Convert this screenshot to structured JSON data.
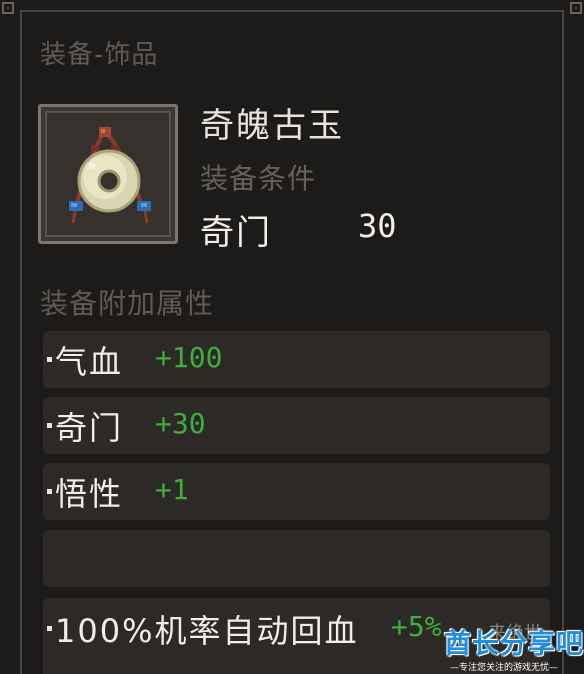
{
  "tooltip": {
    "category": "装备-饰品",
    "item": {
      "name": "奇魄古玉",
      "icon": "jade-pendant-icon"
    },
    "requirement": {
      "label": "装备条件",
      "stat": "奇门",
      "value": "30"
    },
    "attributes_title": "装备附加属性",
    "attributes": [
      {
        "stat": "气血",
        "bonus": "+100"
      },
      {
        "stat": "奇门",
        "bonus": "+30"
      },
      {
        "stat": "悟性",
        "bonus": "+1"
      },
      {
        "stat": "",
        "bonus": ""
      },
      {
        "stat": "100%机率自动回血",
        "bonus": "+5%"
      }
    ]
  },
  "watermark": {
    "title": "酋长分享吧",
    "subtitle": "—专注您关注的游戏无忧—",
    "small": "来绝世"
  },
  "colors": {
    "background": "#1d1b19",
    "row": "#2c2926",
    "bonus_green": "#3fae3c",
    "muted": "#5f5a55",
    "watermark_blue": "#1f8ee0"
  }
}
